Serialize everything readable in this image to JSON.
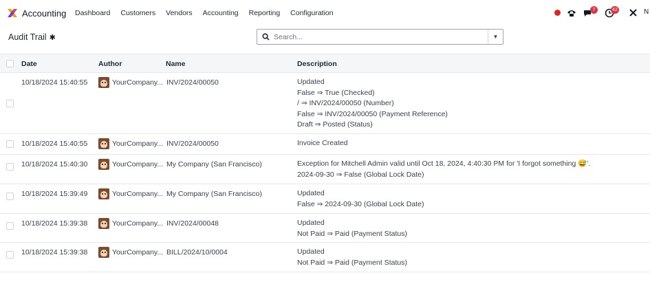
{
  "app": {
    "name": "Accounting",
    "logo_icon": "accounting-logo-icon"
  },
  "menu": [
    "Dashboard",
    "Customers",
    "Vendors",
    "Accounting",
    "Reporting",
    "Configuration"
  ],
  "systray": {
    "messages_count": "7",
    "activity_count": "42"
  },
  "control_panel": {
    "title": "Audit Trail",
    "search_placeholder": "Search..."
  },
  "table": {
    "columns": [
      "Date",
      "Author",
      "Name",
      "Description"
    ],
    "rows": [
      {
        "date": "10/18/2024 15:40:55",
        "author": "YourCompany...",
        "name": "INV/2024/00050",
        "description": [
          "Updated",
          "False ⇒ True (Checked)",
          "/ ⇒ INV/2024/00050 (Number)",
          "False ⇒ INV/2024/00050 (Payment Reference)",
          "Draft ⇒ Posted (Status)"
        ]
      },
      {
        "date": "10/18/2024 15:40:55",
        "author": "YourCompany...",
        "name": "INV/2024/00050",
        "description": [
          "Invoice Created"
        ]
      },
      {
        "date": "10/18/2024 15:40:30",
        "author": "YourCompany...",
        "name": "My Company (San Francisco)",
        "description": [
          "Exception for Mitchell Admin valid until Oct 18, 2024, 4:40:30 PM for 'I forgot something 😅'.",
          "2024-09-30 ⇒ False (Global Lock Date)"
        ]
      },
      {
        "date": "10/18/2024 15:39:49",
        "author": "YourCompany...",
        "name": "My Company (San Francisco)",
        "description": [
          "Updated",
          "False ⇒ 2024-09-30 (Global Lock Date)"
        ]
      },
      {
        "date": "10/18/2024 15:39:38",
        "author": "YourCompany...",
        "name": "INV/2024/00048",
        "description": [
          "Updated",
          "Not Paid ⇒ Paid (Payment Status)"
        ]
      },
      {
        "date": "10/18/2024 15:39:38",
        "author": "YourCompany...",
        "name": "BILL/2024/10/0004",
        "description": [
          "Updated",
          "Not Paid ⇒ Paid (Payment Status)"
        ]
      }
    ]
  }
}
